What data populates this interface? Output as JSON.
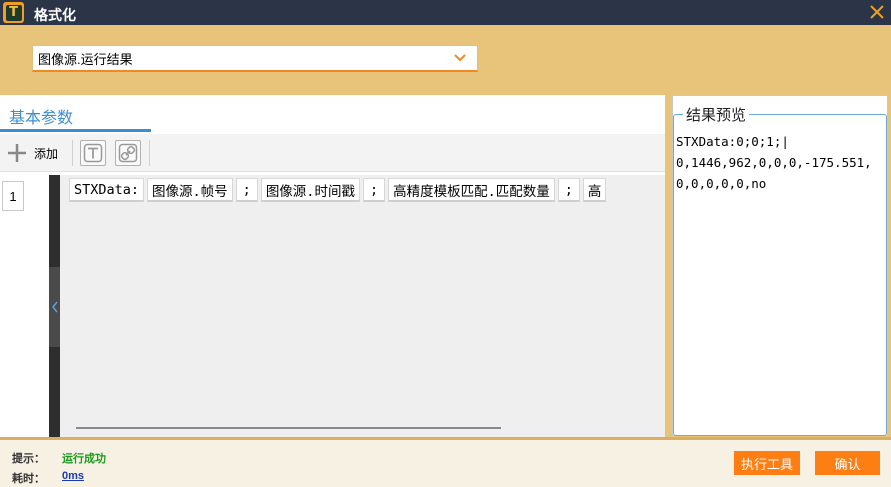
{
  "window": {
    "title": "格式化",
    "app_icon": "text-format-icon",
    "close_icon": "close-icon"
  },
  "source_select": {
    "value": "图像源.运行结果"
  },
  "left_panel": {
    "tab_label": "基本参数",
    "toolbar": {
      "add_label": "添加",
      "icons": [
        "plus-icon",
        "text-icon",
        "link-icon"
      ]
    },
    "row_index": "1",
    "chips": [
      "STXData:",
      "图像源.帧号",
      ";",
      "图像源.时间戳",
      ";",
      "高精度模板匹配.匹配数量",
      ";",
      "高"
    ]
  },
  "right_panel": {
    "legend": "结果预览",
    "preview_text": "STXData:0;0;1;|\n0,1446,962,0,0,0,-175.551,0,0,0,0,0,no"
  },
  "footer": {
    "hint_label": "提示：",
    "hint_value": "运行成功",
    "time_label": "耗时：",
    "time_value": "0ms",
    "run_button": "执行工具",
    "confirm_button": "确认"
  },
  "colors": {
    "accent": "#ff7e14",
    "title_bar": "#2b3547",
    "tab_blue": "#3a8fd0",
    "success": "#1a9a1a"
  }
}
